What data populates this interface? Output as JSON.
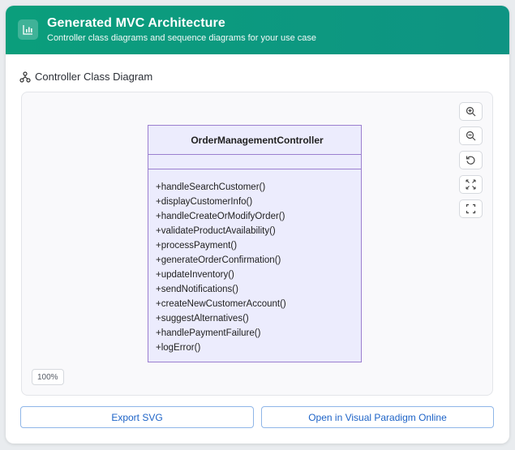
{
  "header": {
    "title": "Generated MVC Architecture",
    "subtitle": "Controller class diagrams and sequence diagrams for your use case",
    "icon": "bar-chart-icon",
    "accent_color": "#0b9e7c"
  },
  "section": {
    "label": "Controller Class Diagram",
    "icon": "hierarchy-icon"
  },
  "diagram": {
    "class_name": "OrderManagementController",
    "methods": [
      "+handleSearchCustomer()",
      "+displayCustomerInfo()",
      "+handleCreateOrModifyOrder()",
      "+validateProductAvailability()",
      "+processPayment()",
      "+generateOrderConfirmation()",
      "+updateInventory()",
      "+sendNotifications()",
      "+createNewCustomerAccount()",
      "+suggestAlternatives()",
      "+handlePaymentFailure()",
      "+logError()"
    ],
    "zoom_level": "100%",
    "controls": [
      "zoom-in-icon",
      "zoom-out-icon",
      "reset-icon",
      "fit-icon",
      "fullscreen-icon"
    ],
    "class_fill": "#ececfd",
    "class_border": "#9b7fcf"
  },
  "footer": {
    "export_label": "Export SVG",
    "open_label": "Open in Visual Paradigm Online"
  }
}
